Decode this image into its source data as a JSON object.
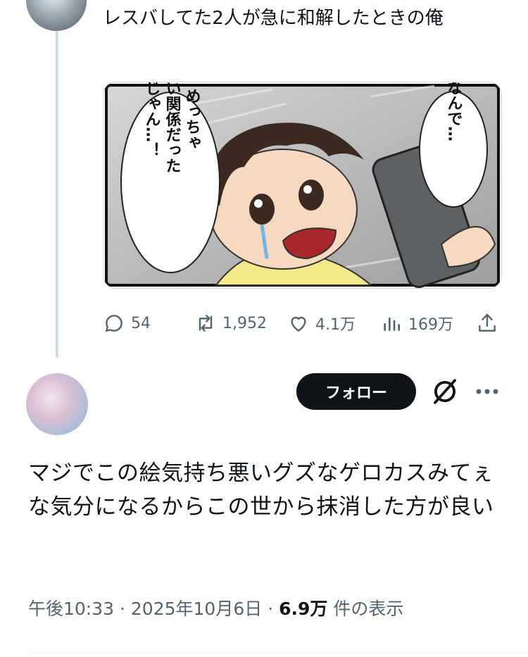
{
  "quoted_tweet": {
    "text": "レスバしてた2人が急に和解したときの俺",
    "image": {
      "speech_left": "めっちゃ\nいい関係だった\nじゃん…！",
      "speech_right": "なんで…"
    },
    "stats": {
      "replies": "54",
      "retweets": "1,952",
      "likes": "4.1万",
      "views": "169万"
    }
  },
  "reply": {
    "follow_label": "フォロー",
    "text": "マジでこの絵気持ち悪いグズなゲロカスみてぇな気分になるからこの世から抹消した方が良い",
    "time": "午後10:33",
    "date": "2025年10月6日",
    "separator": "·",
    "views_count": "6.9万",
    "views_label": "件の表示"
  },
  "icons": {
    "reply": "reply-icon",
    "retweet": "retweet-icon",
    "like": "heart-icon",
    "views": "views-icon",
    "share": "share-icon",
    "grok": "grok-icon",
    "more": "more-icon"
  }
}
